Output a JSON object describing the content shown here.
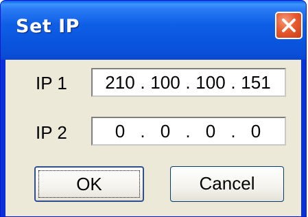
{
  "window": {
    "title": "Set IP",
    "close_icon": "close-icon"
  },
  "fields": [
    {
      "label": "IP 1",
      "octets": [
        "210",
        "100",
        "100",
        "151"
      ],
      "separator": "."
    },
    {
      "label": "IP 2",
      "octets": [
        "0",
        "0",
        "0",
        "0"
      ],
      "separator": "."
    }
  ],
  "buttons": {
    "ok": "OK",
    "cancel": "Cancel"
  },
  "colors": {
    "titlebar": "#0a55dd",
    "client": "#ece9d8",
    "close": "#e85b2f"
  }
}
